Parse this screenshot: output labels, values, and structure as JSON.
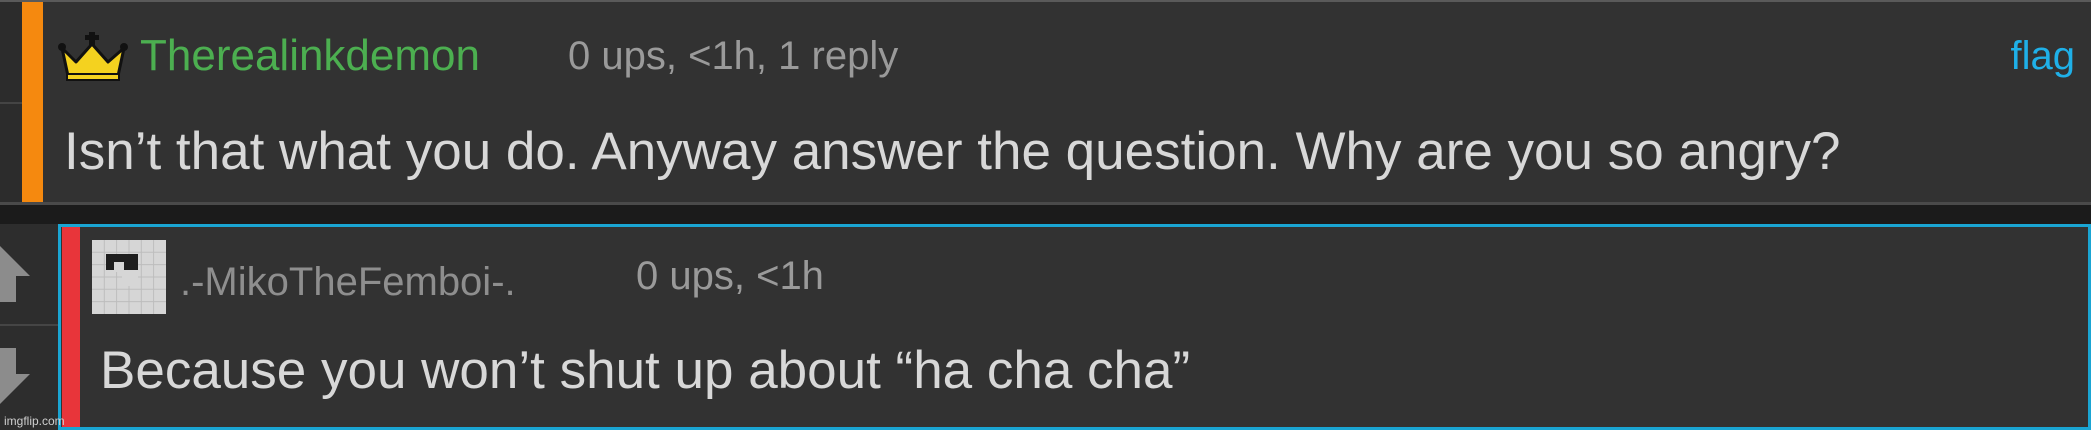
{
  "comments": [
    {
      "username": "Therealinkdemon",
      "meta": "0 ups, <1h, 1 reply",
      "flag_label": "flag",
      "body": "Isn’t that what you do. Anyway answer the question. Why are you so angry?",
      "badge_icon": "crown-icon",
      "accent_color": "#f5890f",
      "username_color": "#4caf50"
    },
    {
      "username": ".-MikoTheFemboi-.",
      "meta": "0 ups, <1h",
      "body": "Because you won’t shut up about “ha cha cha”",
      "avatar_icon": "default-avatar-icon",
      "accent_color": "#e8353a",
      "highlight_color": "#1aa5d3"
    }
  ],
  "watermark": "imgflip.com"
}
